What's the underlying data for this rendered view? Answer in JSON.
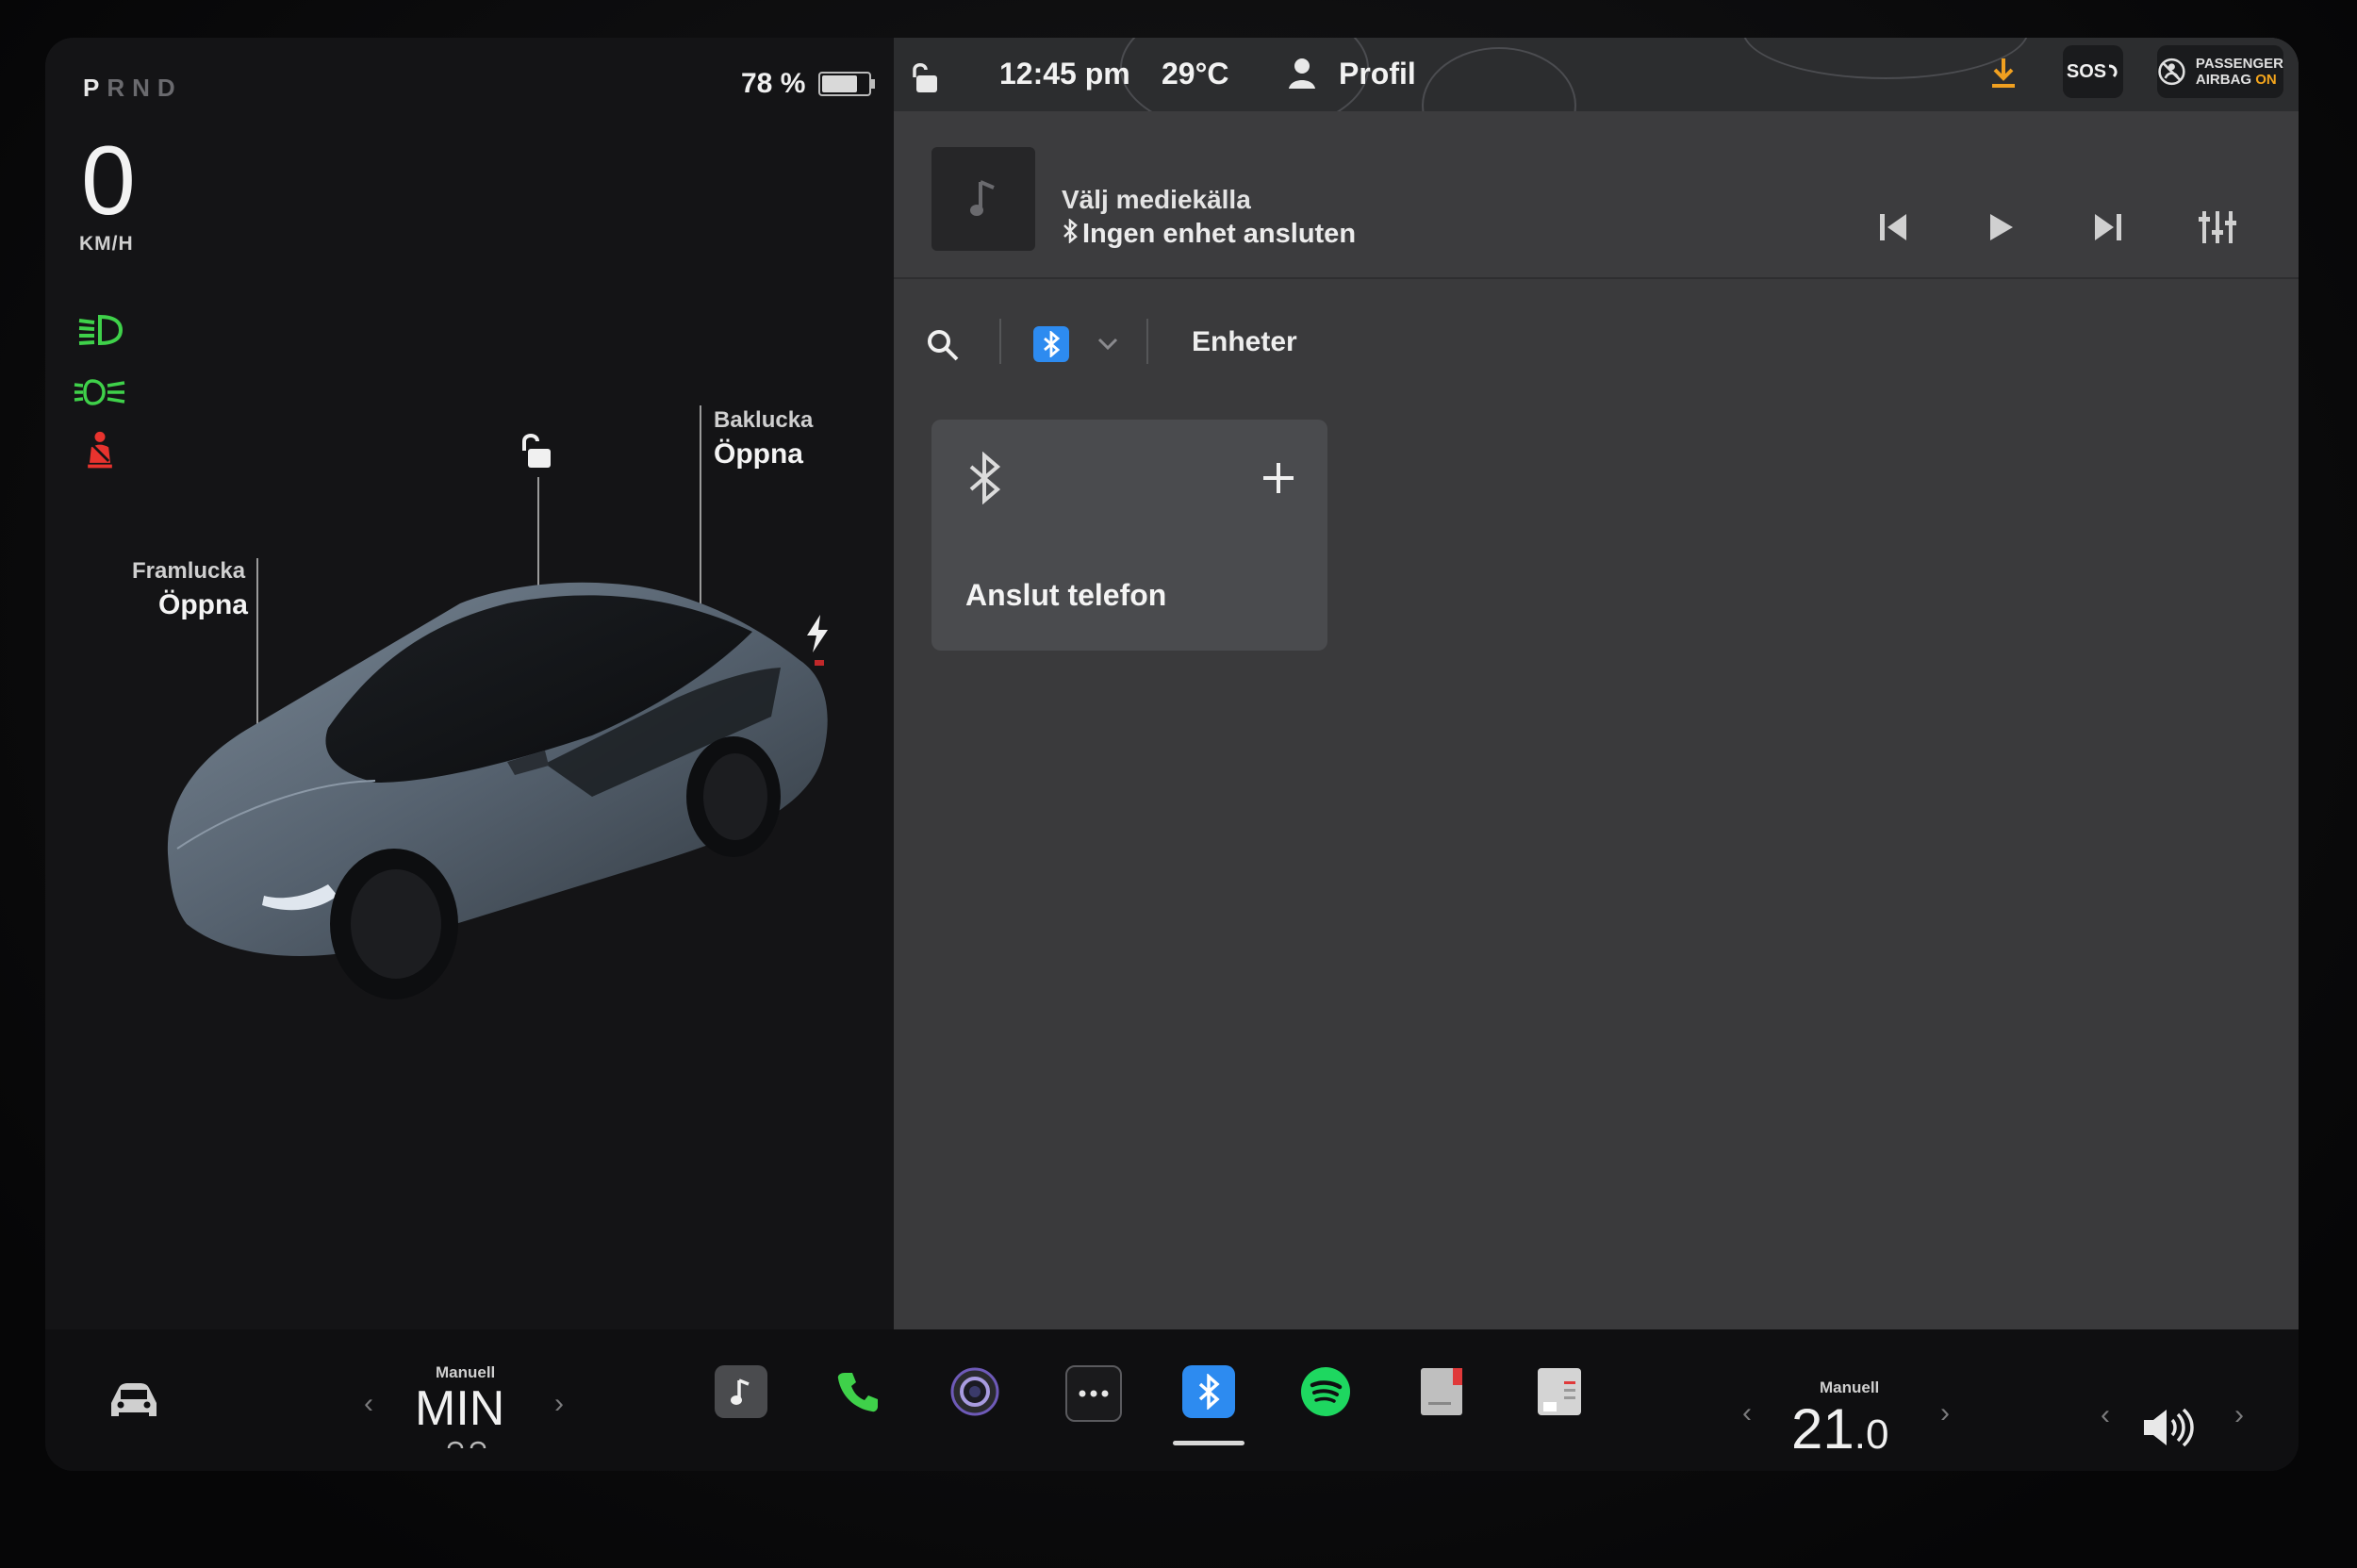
{
  "left_panel": {
    "gear": {
      "selected": "P",
      "others": "RND"
    },
    "battery": {
      "text": "78 %",
      "level": 0.78
    },
    "speed": {
      "value": "0",
      "unit": "KM/H"
    },
    "indicators": [
      {
        "icon": "headlights-icon",
        "color": "#3fd14a"
      },
      {
        "icon": "parking-lights-icon",
        "color": "#3fd14a"
      },
      {
        "icon": "seatbelt-warning-icon",
        "color": "#e8332e"
      }
    ],
    "trunk": {
      "label": "Baklucka",
      "action": "Öppna"
    },
    "frunk": {
      "label": "Framlucka",
      "action": "Öppna"
    }
  },
  "status_bar": {
    "time": "12:45 pm",
    "temperature": "29°C",
    "profile": "Profil",
    "download_color": "#f0a020",
    "sos": "SOS",
    "airbag": {
      "line1": "PASSENGER",
      "line2_prefix": "AIRBAG",
      "line2_state": "ON"
    }
  },
  "media": {
    "title": "Välj mediekälla",
    "subtitle": "Ingen enhet ansluten"
  },
  "toolbar": {
    "devices_label": "Enheter"
  },
  "connect_card": {
    "label": "Anslut telefon"
  },
  "dock": {
    "left_climate": {
      "mode": "Manuell",
      "value": "MIN"
    },
    "right_climate": {
      "mode": "Manuell",
      "value": "21",
      "decimal": ".0"
    },
    "apps": [
      {
        "name": "music-app-icon"
      },
      {
        "name": "phone-app-icon"
      },
      {
        "name": "camera-app-icon"
      },
      {
        "name": "more-apps-icon"
      },
      {
        "name": "bluetooth-app-icon"
      },
      {
        "name": "spotify-app-icon"
      },
      {
        "name": "manual-app-icon"
      },
      {
        "name": "notes-app-icon"
      }
    ]
  }
}
